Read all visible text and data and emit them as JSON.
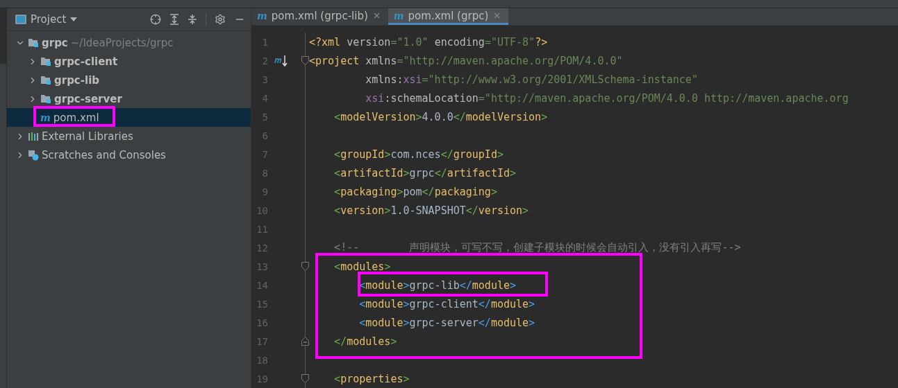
{
  "project_panel": {
    "title": "Project"
  },
  "tree": [
    {
      "label": "grpc",
      "path": "~/IdeaProjects/grpc",
      "kind": "module",
      "expanded": true,
      "selected": false,
      "children": [
        {
          "label": "grpc-client",
          "kind": "module",
          "expanded": false,
          "selected": false
        },
        {
          "label": "grpc-lib",
          "kind": "module",
          "expanded": false,
          "selected": false
        },
        {
          "label": "grpc-server",
          "kind": "module",
          "expanded": false,
          "selected": false
        },
        {
          "label": "pom.xml",
          "kind": "maven",
          "icon": "m",
          "selected": true
        }
      ]
    },
    {
      "label": "External Libraries",
      "kind": "libraries",
      "expanded": false,
      "selected": false
    },
    {
      "label": "Scratches and Consoles",
      "kind": "scratches",
      "expanded": false,
      "selected": false
    }
  ],
  "tabs": [
    {
      "icon": "m",
      "label": "pom.xml (grpc-lib)",
      "selected": false
    },
    {
      "icon": "m",
      "label": "pom.xml (grpc)",
      "selected": true
    }
  ],
  "lines": [
    {
      "number": "1",
      "tokens": [
        {
          "kind": "brace1",
          "text": "<?"
        },
        {
          "kind": "tag",
          "text": "xml "
        },
        {
          "kind": "attr",
          "text": "version"
        },
        {
          "kind": "value",
          "text": "=\"1.0\" "
        },
        {
          "kind": "attr",
          "text": "encoding"
        },
        {
          "kind": "value",
          "text": "=\"UTF-8\""
        },
        {
          "kind": "brace1",
          "text": "?>"
        }
      ]
    },
    {
      "number": "2",
      "maven_marker": true,
      "fold_start": true,
      "tokens": [
        {
          "kind": "brace1",
          "text": "<"
        },
        {
          "kind": "tag",
          "text": "project "
        },
        {
          "kind": "attr",
          "text": "xmlns"
        },
        {
          "kind": "value",
          "text": "=\"http://maven.apache.org/POM/4.0.0\""
        }
      ]
    },
    {
      "number": "3",
      "tokens": [
        {
          "kind": "attr",
          "text": "         xmlns:"
        },
        {
          "kind": "ns",
          "text": "xsi"
        },
        {
          "kind": "value",
          "text": "=\"http://www.w3.org/2001/XMLSchema-instance\""
        }
      ]
    },
    {
      "number": "4",
      "tokens": [
        {
          "kind": "ns",
          "text": "         xsi"
        },
        {
          "kind": "attr",
          "text": ":schemaLocation"
        },
        {
          "kind": "value",
          "text": "=\"http://maven.apache.org/POM/4.0.0 http://maven.apache.org"
        }
      ]
    },
    {
      "number": "5",
      "tokens": [
        {
          "kind": "brace2",
          "text": "    <"
        },
        {
          "kind": "tag",
          "text": "modelVersion"
        },
        {
          "kind": "brace2",
          "text": ">"
        },
        {
          "kind": "text",
          "text": "4.0.0"
        },
        {
          "kind": "brace2",
          "text": "</"
        },
        {
          "kind": "tag",
          "text": "modelVersion"
        },
        {
          "kind": "brace2",
          "text": ">"
        }
      ]
    },
    {
      "number": "6"
    },
    {
      "number": "7",
      "tokens": [
        {
          "kind": "brace2",
          "text": "    <"
        },
        {
          "kind": "tag",
          "text": "groupId"
        },
        {
          "kind": "brace2",
          "text": ">"
        },
        {
          "kind": "text",
          "text": "com.nces"
        },
        {
          "kind": "brace2",
          "text": "</"
        },
        {
          "kind": "tag",
          "text": "groupId"
        },
        {
          "kind": "brace2",
          "text": ">"
        }
      ]
    },
    {
      "number": "8",
      "tokens": [
        {
          "kind": "brace2",
          "text": "    <"
        },
        {
          "kind": "tag",
          "text": "artifactId"
        },
        {
          "kind": "brace2",
          "text": ">"
        },
        {
          "kind": "text",
          "text": "grpc"
        },
        {
          "kind": "brace2",
          "text": "</"
        },
        {
          "kind": "tag",
          "text": "artifactId"
        },
        {
          "kind": "brace2",
          "text": ">"
        }
      ]
    },
    {
      "number": "9",
      "tokens": [
        {
          "kind": "brace2",
          "text": "    <"
        },
        {
          "kind": "tag",
          "text": "packaging"
        },
        {
          "kind": "brace2",
          "text": ">"
        },
        {
          "kind": "text",
          "text": "pom"
        },
        {
          "kind": "brace2",
          "text": "</"
        },
        {
          "kind": "tag",
          "text": "packaging"
        },
        {
          "kind": "brace2",
          "text": ">"
        }
      ]
    },
    {
      "number": "10",
      "tokens": [
        {
          "kind": "brace2",
          "text": "    <"
        },
        {
          "kind": "tag",
          "text": "version"
        },
        {
          "kind": "brace2",
          "text": ">"
        },
        {
          "kind": "text",
          "text": "1.0-SNAPSHOT"
        },
        {
          "kind": "brace2",
          "text": "</"
        },
        {
          "kind": "tag",
          "text": "version"
        },
        {
          "kind": "brace2",
          "text": ">"
        }
      ]
    },
    {
      "number": "11"
    },
    {
      "number": "12",
      "tokens": [
        {
          "kind": "comment",
          "text": "    <!--        声明模块，可写不写，创建子模块的时候会自动引入，没有引入再写-->"
        }
      ]
    },
    {
      "number": "13",
      "fold_start": true,
      "tokens": [
        {
          "kind": "brace2",
          "text": "    <"
        },
        {
          "kind": "tag",
          "text": "modules"
        },
        {
          "kind": "brace2",
          "text": ">"
        }
      ]
    },
    {
      "number": "14",
      "tokens": [
        {
          "kind": "brace3",
          "text": "        <"
        },
        {
          "kind": "tag",
          "text": "module"
        },
        {
          "kind": "brace3",
          "text": ">"
        },
        {
          "kind": "text",
          "text": "grpc-lib"
        },
        {
          "kind": "brace3",
          "text": "</"
        },
        {
          "kind": "tag",
          "text": "module"
        },
        {
          "kind": "brace3",
          "text": ">"
        }
      ]
    },
    {
      "number": "15",
      "tokens": [
        {
          "kind": "brace3",
          "text": "        <"
        },
        {
          "kind": "tag",
          "text": "module"
        },
        {
          "kind": "brace3",
          "text": ">"
        },
        {
          "kind": "text",
          "text": "grpc-client"
        },
        {
          "kind": "brace3",
          "text": "</"
        },
        {
          "kind": "tag",
          "text": "module"
        },
        {
          "kind": "brace3",
          "text": ">"
        }
      ]
    },
    {
      "number": "16",
      "tokens": [
        {
          "kind": "brace3",
          "text": "        <"
        },
        {
          "kind": "tag",
          "text": "module"
        },
        {
          "kind": "brace3",
          "text": ">"
        },
        {
          "kind": "text",
          "text": "grpc-server"
        },
        {
          "kind": "brace3",
          "text": "</"
        },
        {
          "kind": "tag",
          "text": "module"
        },
        {
          "kind": "brace3",
          "text": ">"
        }
      ]
    },
    {
      "number": "17",
      "fold_end": true,
      "tokens": [
        {
          "kind": "brace2",
          "text": "    </"
        },
        {
          "kind": "tag",
          "text": "modules"
        },
        {
          "kind": "brace2",
          "text": ">"
        }
      ]
    },
    {
      "number": "18"
    },
    {
      "number": "19",
      "fold_start": true,
      "tokens": [
        {
          "kind": "brace2",
          "text": "    <"
        },
        {
          "kind": "tag",
          "text": "properties"
        },
        {
          "kind": "brace2",
          "text": ">"
        }
      ]
    }
  ]
}
